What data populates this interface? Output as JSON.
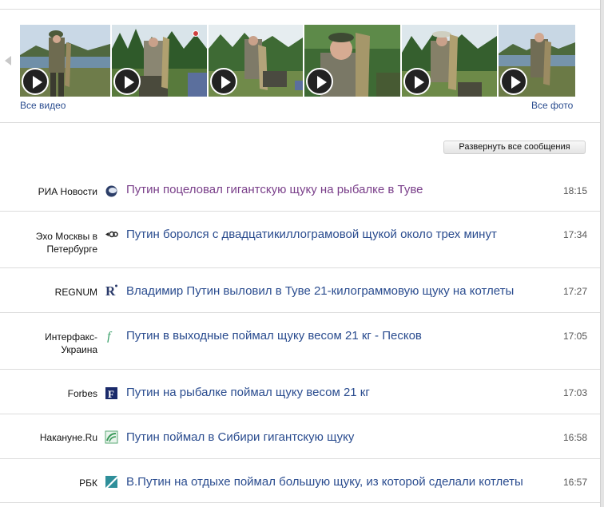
{
  "gallery": {
    "all_video_label": "Все видео",
    "all_photo_label": "Все фото"
  },
  "toolbar": {
    "expand_all_label": "Развернуть все сообщения"
  },
  "news": [
    {
      "source": "РИА Новости",
      "headline": "Путин поцеловал гигантскую щуку на рыбалке в Туве",
      "time": "18:15",
      "logo": "ria-logo-icon",
      "visited": true
    },
    {
      "source": "Эхо Москвы в Петербурге",
      "headline": "Путин боролся с двадцатикиллограмовой щукой около трех минут",
      "time": "17:34",
      "logo": "echo-logo-icon",
      "visited": false
    },
    {
      "source": "REGNUM",
      "headline": "Владимир Путин выловил в Туве 21-килограммовую щуку на котлеты",
      "time": "17:27",
      "logo": "regnum-logo-icon",
      "visited": false
    },
    {
      "source": "Интерфакс-Украина",
      "headline": "Путин в выходные поймал щуку весом 21 кг - Песков",
      "time": "17:05",
      "logo": "interfax-logo-icon",
      "visited": false
    },
    {
      "source": "Forbes",
      "headline": "Путин на рыбалке поймал щуку весом 21 кг",
      "time": "17:03",
      "logo": "forbes-logo-icon",
      "visited": false
    },
    {
      "source": "Накануне.Ru",
      "headline": "Путин поймал в Сибири гигантскую щуку",
      "time": "16:58",
      "logo": "nakanune-logo-icon",
      "visited": false
    },
    {
      "source": "РБК",
      "headline": "В.Путин на отдыхе поймал большую щуку, из которой сделали котлеты",
      "time": "16:57",
      "logo": "rbc-logo-icon",
      "visited": false
    }
  ],
  "colors": {
    "link": "#2a4c8f",
    "visited_link": "#7a3f8a",
    "separator": "#dcdcdc"
  }
}
